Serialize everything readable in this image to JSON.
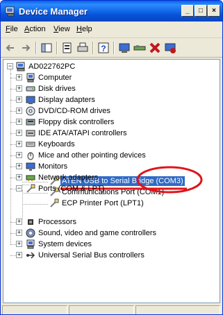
{
  "window": {
    "title": "Device Manager"
  },
  "caption_buttons": {
    "minimize": "_",
    "maximize": "□",
    "close": "×"
  },
  "menu": [
    {
      "label": "File",
      "accel": "F",
      "rest": "ile"
    },
    {
      "label": "Action",
      "accel": "A",
      "rest": "ction"
    },
    {
      "label": "View",
      "accel": "V",
      "rest": "iew"
    },
    {
      "label": "Help",
      "accel": "H",
      "rest": "elp"
    }
  ],
  "tree": {
    "root": "AD022762PC",
    "items": [
      "Computer",
      "Disk drives",
      "Display adapters",
      "DVD/CD-ROM drives",
      "Floppy disk controllers",
      "IDE ATA/ATAPI controllers",
      "Keyboards",
      "Mice and other pointing devices",
      "Monitors",
      "Network adapters",
      "Ports (COM & LPT)",
      "Processors",
      "Sound, video and game controllers",
      "System devices",
      "Universal Serial Bus controllers"
    ],
    "ports": [
      "ATEN USB to Serial Bridge (COM3)",
      "Communications Port (COM1)",
      "ECP Printer Port (LPT1)"
    ],
    "expand_glyph": "+",
    "collapse_glyph": "−"
  },
  "annotation_colors": {
    "highlight": "#e0141b",
    "selection": "#316ac5"
  }
}
